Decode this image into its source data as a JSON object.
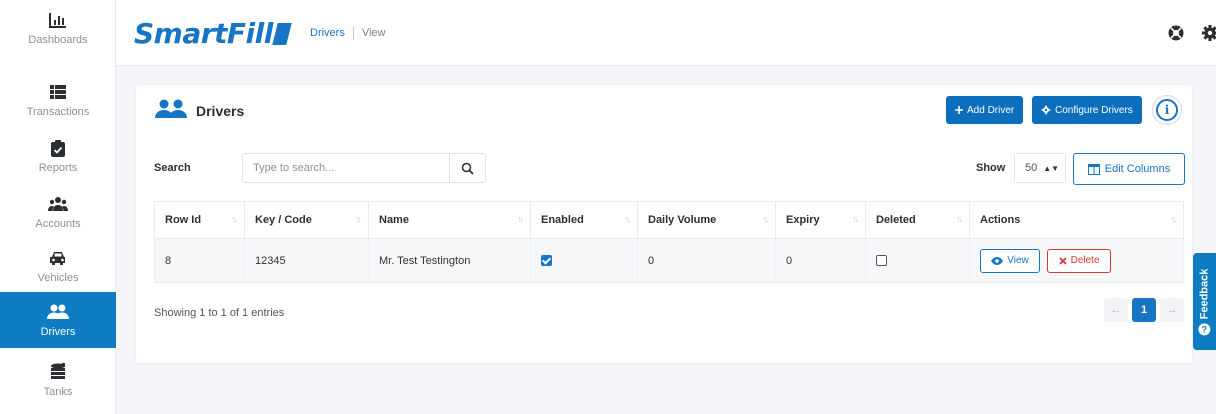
{
  "sidebar": {
    "items": [
      {
        "label": "Dashboards",
        "icon": "bar-chart-icon"
      },
      {
        "label": "Transactions",
        "icon": "list-icon"
      },
      {
        "label": "Reports",
        "icon": "clipboard-icon"
      },
      {
        "label": "Accounts",
        "icon": "users-icon"
      },
      {
        "label": "Vehicles",
        "icon": "car-icon"
      },
      {
        "label": "Drivers",
        "icon": "user-pair-icon",
        "active": true
      },
      {
        "label": "Tanks",
        "icon": "coins-icon"
      }
    ]
  },
  "header": {
    "logo": "SmartFill",
    "breadcrumb": {
      "link": "Drivers",
      "current": "View"
    }
  },
  "card": {
    "title": "Drivers",
    "add_driver_label": "Add Driver",
    "configure_drivers_label": "Configure Drivers",
    "info_label": "i"
  },
  "search": {
    "label": "Search",
    "placeholder": "Type to search..."
  },
  "show": {
    "label": "Show",
    "value": "50"
  },
  "edit_columns_label": "Edit Columns",
  "table": {
    "columns": [
      "Row Id",
      "Key / Code",
      "Name",
      "Enabled",
      "Daily Volume",
      "Expiry",
      "Deleted",
      "Actions"
    ],
    "rows": [
      {
        "row_id": "8",
        "key_code": "12345",
        "name": "Mr. Test Testington",
        "enabled": true,
        "daily_volume": "0",
        "expiry": "0",
        "deleted": false,
        "view_label": "View",
        "delete_label": "Delete"
      }
    ]
  },
  "entries_text": "Showing 1 to 1 of 1 entries",
  "pagination": {
    "prev": "←",
    "current": "1",
    "next": "→"
  },
  "feedback_label": "Feedback",
  "colors": {
    "primary": "#1775c6",
    "sidebar_active": "#0d7cc2",
    "danger": "#e03434"
  }
}
